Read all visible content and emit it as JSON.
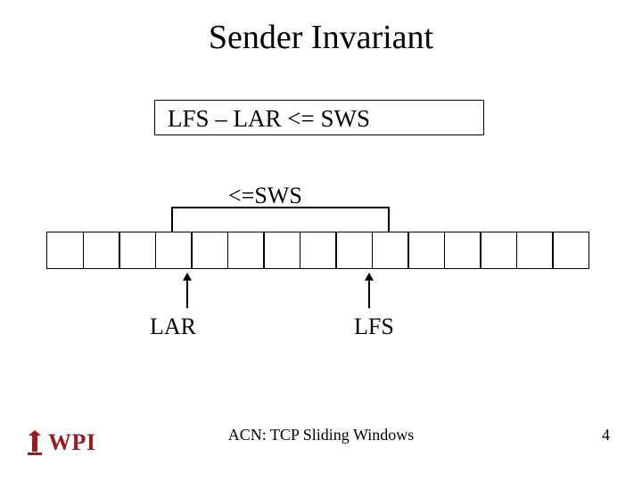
{
  "title": "Sender Invariant",
  "formula": "LFS – LAR <= SWS",
  "window_label": "<=SWS",
  "cell_count": 15,
  "pointers": {
    "lar": "LAR",
    "lfs": "LFS"
  },
  "footer": "ACN: TCP Sliding Windows",
  "slide_number": "4",
  "logo": {
    "text": "WPI",
    "color": "#9a1b1e"
  }
}
